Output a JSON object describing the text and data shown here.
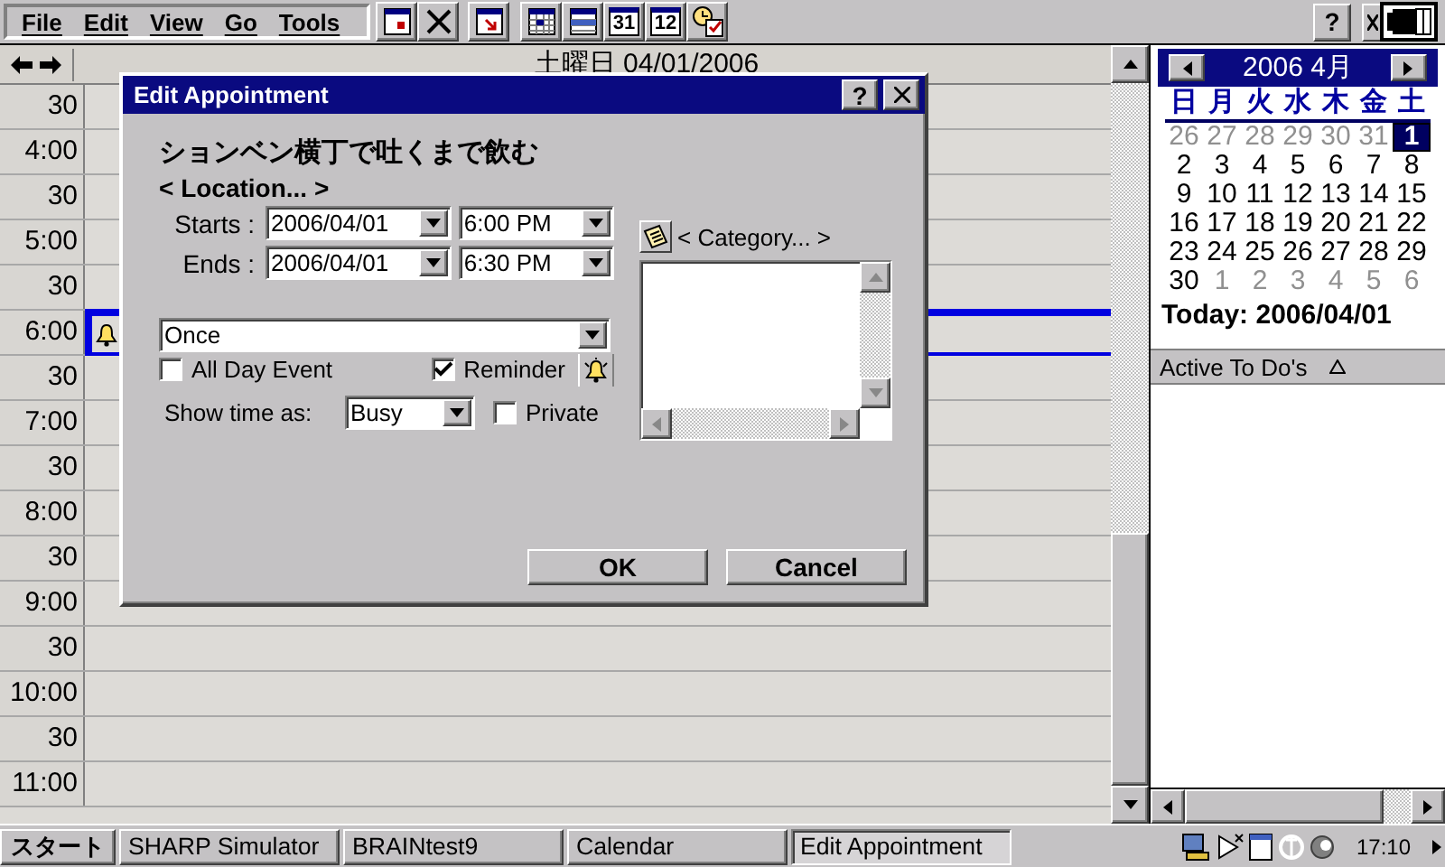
{
  "menu": [
    {
      "label": "File"
    },
    {
      "label": "Edit"
    },
    {
      "label": "View"
    },
    {
      "label": "Go"
    },
    {
      "label": "Tools"
    }
  ],
  "toolbar": [
    {
      "kind": "new"
    },
    {
      "kind": "delete"
    },
    {
      "kind": "goto"
    },
    {
      "kind": "day"
    },
    {
      "kind": "week"
    },
    {
      "kind": "month",
      "label": "31"
    },
    {
      "kind": "year",
      "label": "12"
    },
    {
      "kind": "todo"
    }
  ],
  "window_buttons": {
    "help": "?"
  },
  "day_view": {
    "date": "土曜日 04/01/2006",
    "slots": [
      {
        "label": "30",
        "has_appointment": false
      },
      {
        "label": "4:00",
        "has_appointment": false
      },
      {
        "label": "30",
        "has_appointment": false
      },
      {
        "label": "5:00",
        "has_appointment": false
      },
      {
        "label": "30",
        "has_appointment": false
      },
      {
        "label": "6:00",
        "has_appointment": true
      },
      {
        "label": "30",
        "has_appointment": false
      },
      {
        "label": "7:00",
        "has_appointment": false
      },
      {
        "label": "30",
        "has_appointment": false
      },
      {
        "label": "8:00",
        "has_appointment": false
      },
      {
        "label": "30",
        "has_appointment": false
      },
      {
        "label": "9:00",
        "has_appointment": false
      },
      {
        "label": "30",
        "has_appointment": false
      },
      {
        "label": "10:00",
        "has_appointment": false
      },
      {
        "label": "30",
        "has_appointment": false
      },
      {
        "label": "11:00",
        "has_appointment": false
      }
    ]
  },
  "dialog": {
    "title": "Edit Appointment",
    "help": "?",
    "subject": "ションベン横丁で吐くまで飲む",
    "location": "< Location... >",
    "starts_label": "Starts :",
    "start_date": "2006/04/01",
    "start_time": "6:00 PM",
    "ends_label": "Ends :",
    "end_date": "2006/04/01",
    "end_time": "6:30 PM",
    "category": "< Category... >",
    "recurrence": "Once",
    "all_day": {
      "label": "All Day Event",
      "checked": false
    },
    "reminder": {
      "label": "Reminder",
      "checked": true
    },
    "show_time_label": "Show time as:",
    "show_time": "Busy",
    "private": {
      "label": "Private",
      "checked": false
    },
    "buttons": [
      "OK",
      "Cancel"
    ]
  },
  "mini_calendar": {
    "title": "2006 4月",
    "weekdays": [
      "日",
      "月",
      "火",
      "水",
      "木",
      "金",
      "土"
    ],
    "weeks": [
      [
        {
          "day": "26",
          "other_month": true,
          "selected": false
        },
        {
          "day": "27",
          "other_month": true,
          "selected": false
        },
        {
          "day": "28",
          "other_month": true,
          "selected": false
        },
        {
          "day": "29",
          "other_month": true,
          "selected": false
        },
        {
          "day": "30",
          "other_month": true,
          "selected": false
        },
        {
          "day": "31",
          "other_month": true,
          "selected": false
        },
        {
          "day": "1",
          "other_month": false,
          "selected": true
        }
      ],
      [
        {
          "day": "2",
          "other_month": false,
          "selected": false
        },
        {
          "day": "3",
          "other_month": false,
          "selected": false
        },
        {
          "day": "4",
          "other_month": false,
          "selected": false
        },
        {
          "day": "5",
          "other_month": false,
          "selected": false
        },
        {
          "day": "6",
          "other_month": false,
          "selected": false
        },
        {
          "day": "7",
          "other_month": false,
          "selected": false
        },
        {
          "day": "8",
          "other_month": false,
          "selected": false
        }
      ],
      [
        {
          "day": "9",
          "other_month": false,
          "selected": false
        },
        {
          "day": "10",
          "other_month": false,
          "selected": false
        },
        {
          "day": "11",
          "other_month": false,
          "selected": false
        },
        {
          "day": "12",
          "other_month": false,
          "selected": false
        },
        {
          "day": "13",
          "other_month": false,
          "selected": false
        },
        {
          "day": "14",
          "other_month": false,
          "selected": false
        },
        {
          "day": "15",
          "other_month": false,
          "selected": false
        }
      ],
      [
        {
          "day": "16",
          "other_month": false,
          "selected": false
        },
        {
          "day": "17",
          "other_month": false,
          "selected": false
        },
        {
          "day": "18",
          "other_month": false,
          "selected": false
        },
        {
          "day": "19",
          "other_month": false,
          "selected": false
        },
        {
          "day": "20",
          "other_month": false,
          "selected": false
        },
        {
          "day": "21",
          "other_month": false,
          "selected": false
        },
        {
          "day": "22",
          "other_month": false,
          "selected": false
        }
      ],
      [
        {
          "day": "23",
          "other_month": false,
          "selected": false
        },
        {
          "day": "24",
          "other_month": false,
          "selected": false
        },
        {
          "day": "25",
          "other_month": false,
          "selected": false
        },
        {
          "day": "26",
          "other_month": false,
          "selected": false
        },
        {
          "day": "27",
          "other_month": false,
          "selected": false
        },
        {
          "day": "28",
          "other_month": false,
          "selected": false
        },
        {
          "day": "29",
          "other_month": false,
          "selected": false
        }
      ],
      [
        {
          "day": "30",
          "other_month": false,
          "selected": false
        },
        {
          "day": "1",
          "other_month": true,
          "selected": false
        },
        {
          "day": "2",
          "other_month": true,
          "selected": false
        },
        {
          "day": "3",
          "other_month": true,
          "selected": false
        },
        {
          "day": "4",
          "other_month": true,
          "selected": false
        },
        {
          "day": "5",
          "other_month": true,
          "selected": false
        },
        {
          "day": "6",
          "other_month": true,
          "selected": false
        }
      ]
    ],
    "today": "Today: 2006/04/01"
  },
  "todo": {
    "header": "Active To Do's"
  },
  "taskbar": {
    "start": "スタート",
    "tasks": [
      {
        "label": "SHARP Simulator",
        "selected": false
      },
      {
        "label": "BRAINtest9",
        "selected": false
      },
      {
        "label": "Calendar",
        "selected": false
      },
      {
        "label": "Edit Appointment",
        "selected": true
      }
    ],
    "clock": "17:10"
  }
}
